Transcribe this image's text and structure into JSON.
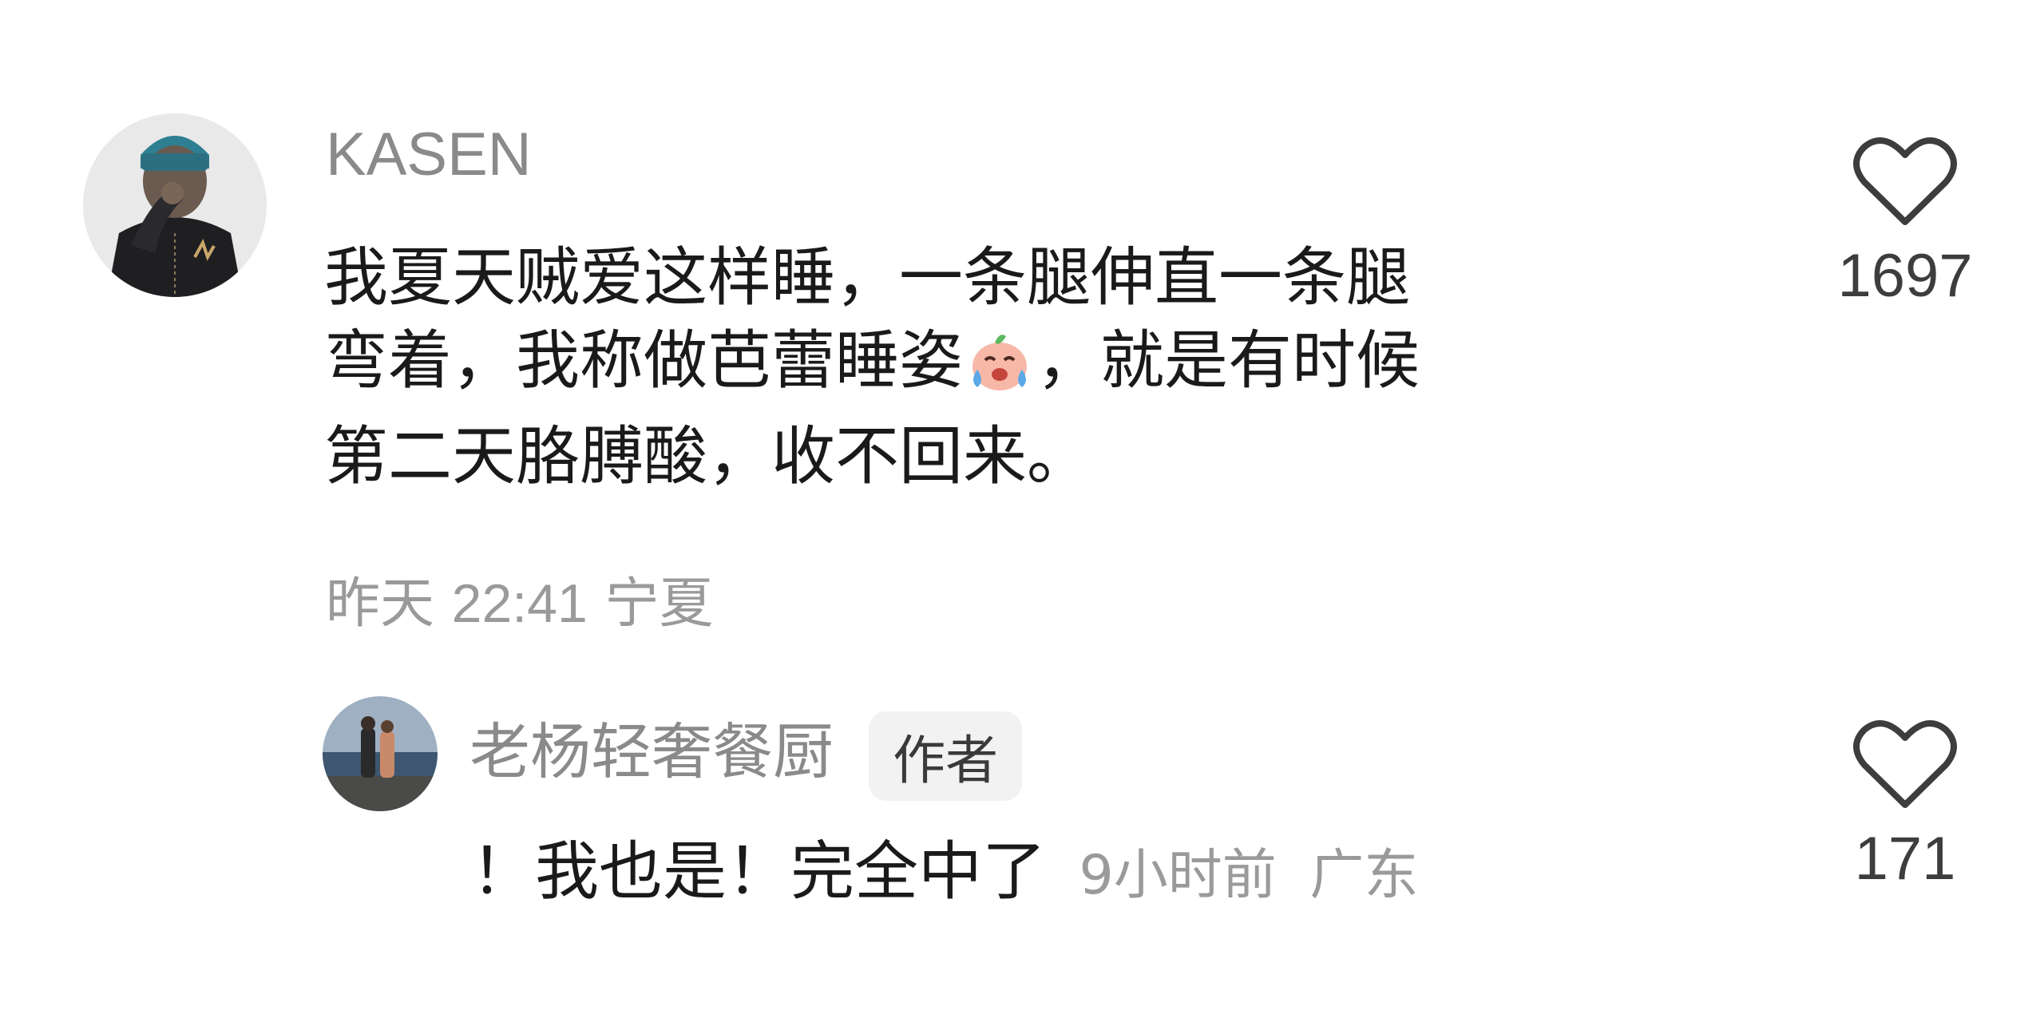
{
  "comment": {
    "username": "KASEN",
    "text_line1": "我夏天贼爱这样睡，一条腿伸直一条腿",
    "text_line2_a": "弯着，我称做芭蕾睡姿",
    "emoji_icon": "crying-laughing-face-emoji",
    "text_line2_b": "，就是有时候",
    "text_line3": "第二天胳膊酸，收不回来。",
    "date": "昨天",
    "time": "22:41",
    "location": "宁夏",
    "likes": "1697"
  },
  "reply": {
    "username": "老杨轻奢餐厨",
    "badge": "作者",
    "text": "！我也是！完全中了",
    "time": "9小时前",
    "location": "广东",
    "likes": "171"
  },
  "colors": {
    "username": "#8a8a8a",
    "text": "#1a1a1a",
    "meta": "#9a9a9a",
    "heart_outline": "#3d3d3d"
  }
}
